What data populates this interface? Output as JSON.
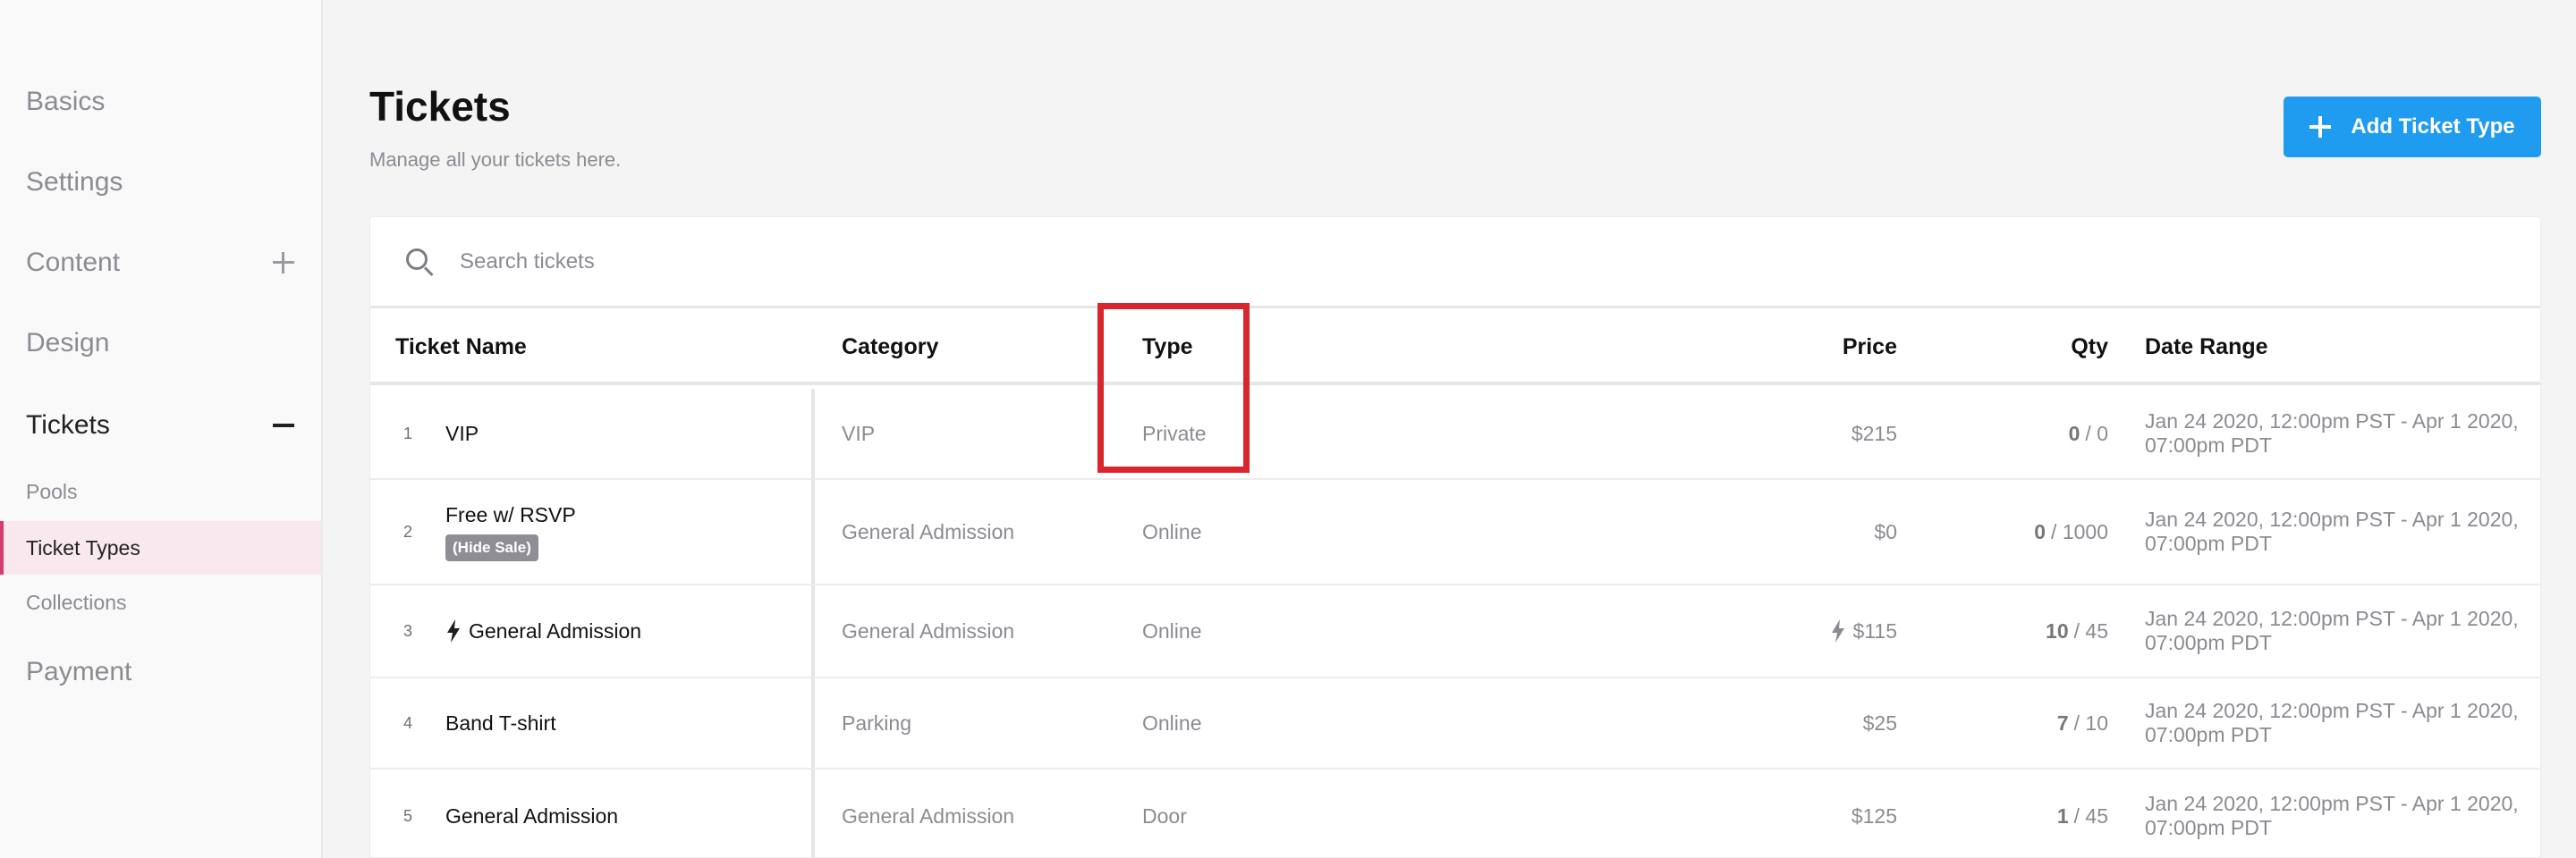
{
  "sidebar": {
    "items": [
      {
        "label": "Basics"
      },
      {
        "label": "Settings"
      },
      {
        "label": "Content"
      },
      {
        "label": "Design"
      },
      {
        "label": "Tickets"
      },
      {
        "label": "Pools"
      },
      {
        "label": "Ticket Types"
      },
      {
        "label": "Collections"
      },
      {
        "label": "Payment"
      }
    ]
  },
  "header": {
    "title": "Tickets",
    "subtitle": "Manage all your tickets here.",
    "add_button_label": "Add Ticket Type"
  },
  "search": {
    "placeholder": "Search tickets"
  },
  "table": {
    "columns": {
      "name": "Ticket Name",
      "category": "Category",
      "type": "Type",
      "price": "Price",
      "qty": "Qty",
      "date_range": "Date Range"
    },
    "rows": [
      {
        "num": "1",
        "name": "VIP",
        "badge": "",
        "category": "VIP",
        "type": "Private",
        "price": "$215",
        "qty_sold": "0",
        "qty_total": "/ 0",
        "date_range": "Jan 24 2020, 12:00pm PST - Apr 1 2020, 07:00pm PDT"
      },
      {
        "num": "2",
        "name": "Free w/ RSVP",
        "badge": "(Hide Sale)",
        "category": "General Admission",
        "type": "Online",
        "price": "$0",
        "qty_sold": "0",
        "qty_total": "/ 1000",
        "date_range": "Jan 24 2020, 12:00pm PST - Apr 1 2020, 07:00pm PDT"
      },
      {
        "num": "3",
        "name": "General Admission",
        "badge": "",
        "category": "General Admission",
        "type": "Online",
        "price": "$115",
        "qty_sold": "10",
        "qty_total": "/ 45",
        "date_range": "Jan 24 2020, 12:00pm PST - Apr 1 2020, 07:00pm PDT"
      },
      {
        "num": "4",
        "name": "Band T-shirt",
        "badge": "",
        "category": "Parking",
        "type": "Online",
        "price": "$25",
        "qty_sold": "7",
        "qty_total": "/ 10",
        "date_range": "Jan 24 2020, 12:00pm PST - Apr 1 2020, 07:00pm PDT"
      },
      {
        "num": "5",
        "name": "General Admission",
        "badge": "",
        "category": "General Admission",
        "type": "Door",
        "price": "$125",
        "qty_sold": "1",
        "qty_total": "/ 45",
        "date_range": "Jan 24 2020, 12:00pm PST - Apr 1 2020, 07:00pm PDT"
      }
    ]
  },
  "colors": {
    "accent": "#1f9bf0",
    "active_nav_border": "#d63c6b",
    "highlight": "#d9262c"
  }
}
